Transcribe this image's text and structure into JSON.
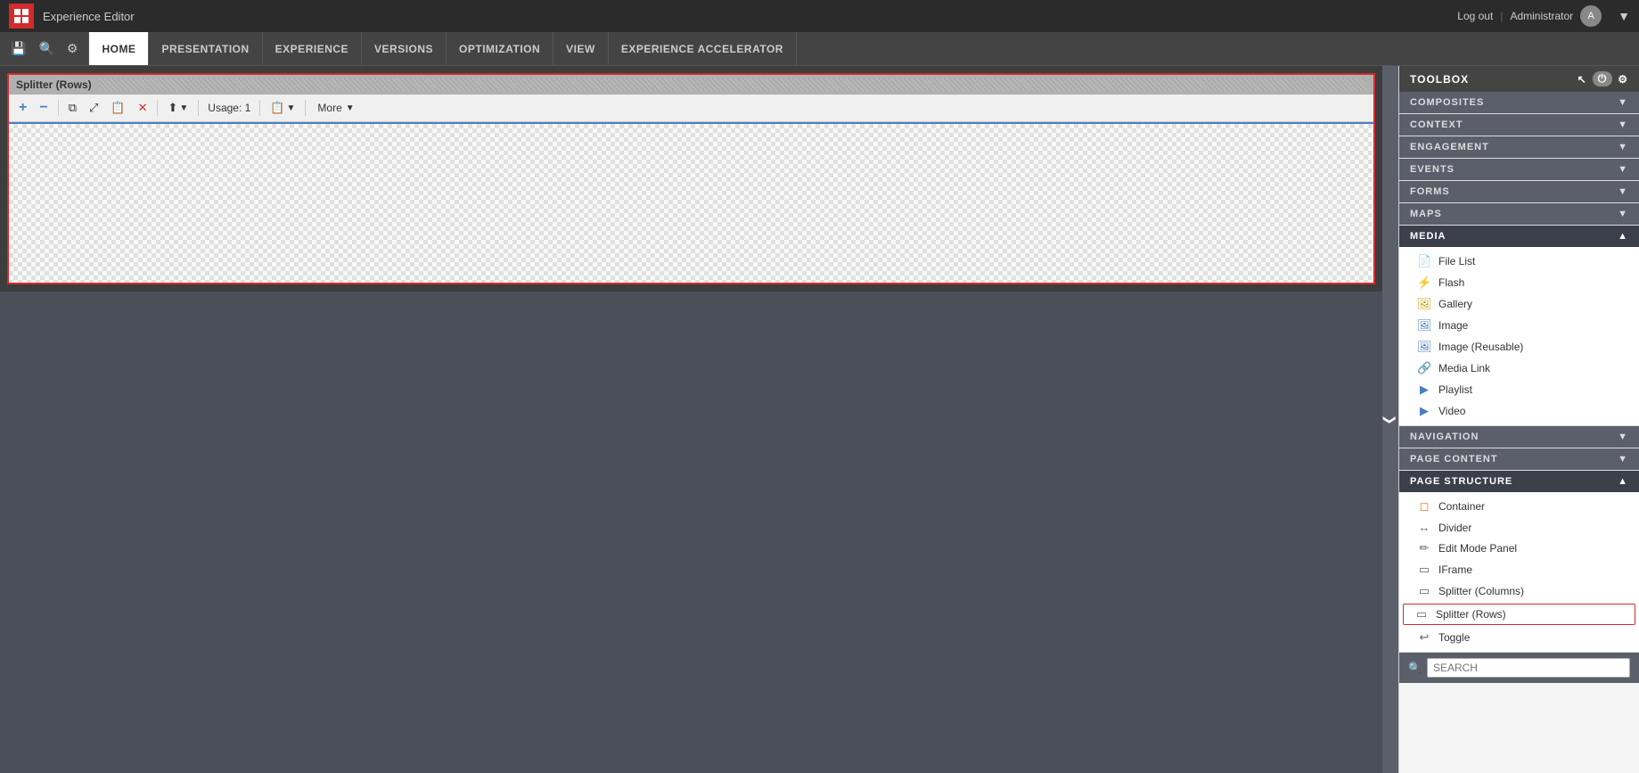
{
  "app": {
    "title": "Experience Editor",
    "logo_label": "Sitecore",
    "logout_label": "Log out",
    "user_label": "Administrator",
    "collapse_icon": "▼"
  },
  "navbar": {
    "tabs": [
      {
        "id": "home",
        "label": "HOME",
        "active": true
      },
      {
        "id": "presentation",
        "label": "PRESENTATION"
      },
      {
        "id": "experience",
        "label": "EXPERIENCE"
      },
      {
        "id": "versions",
        "label": "VERSIONS"
      },
      {
        "id": "optimization",
        "label": "OPTIMIZATION"
      },
      {
        "id": "view",
        "label": "VIEW"
      },
      {
        "id": "experience_accelerator",
        "label": "EXPERIENCE ACCELERATOR"
      }
    ]
  },
  "splitter": {
    "title": "Splitter (Rows)",
    "usage_label": "Usage: 1",
    "more_label": "More",
    "toolbar": {
      "add_icon": "+",
      "remove_icon": "−",
      "copy_icon": "⧉",
      "move_icon": "⤢",
      "paste_icon": "📋",
      "delete_icon": "✕",
      "move_dropdown_icon": "↕",
      "paste_dropdown_icon": "⬇"
    }
  },
  "toolbox": {
    "title": "TOOLBOX",
    "sections": [
      {
        "id": "composites",
        "label": "COMPOSITES",
        "expanded": false
      },
      {
        "id": "context",
        "label": "CONTEXT",
        "expanded": false
      },
      {
        "id": "engagement",
        "label": "ENGAGEMENT",
        "expanded": false
      },
      {
        "id": "events",
        "label": "EVENTS",
        "expanded": false
      },
      {
        "id": "forms",
        "label": "FORMS",
        "expanded": false
      },
      {
        "id": "maps",
        "label": "MAPS",
        "expanded": false
      },
      {
        "id": "media",
        "label": "MEDIA",
        "expanded": true
      },
      {
        "id": "navigation",
        "label": "NAVIGATION",
        "expanded": false
      },
      {
        "id": "page_content",
        "label": "PAGE CONTENT",
        "expanded": false
      },
      {
        "id": "page_structure",
        "label": "PAGE STRUCTURE",
        "expanded": true
      }
    ],
    "media_items": [
      {
        "label": "File List",
        "icon": "📄",
        "icon_type": "doc"
      },
      {
        "label": "Flash",
        "icon": "⚡",
        "icon_type": "flash"
      },
      {
        "label": "Gallery",
        "icon": "🖼",
        "icon_type": "yellow"
      },
      {
        "label": "Image",
        "icon": "🖼",
        "icon_type": "blue"
      },
      {
        "label": "Image (Reusable)",
        "icon": "🖼",
        "icon_type": "blue"
      },
      {
        "label": "Media Link",
        "icon": "🔗",
        "icon_type": "blue"
      },
      {
        "label": "Playlist",
        "icon": "▶",
        "icon_type": "blue"
      },
      {
        "label": "Video",
        "icon": "▶",
        "icon_type": "blue"
      }
    ],
    "page_structure_items": [
      {
        "label": "Container",
        "icon": "◻",
        "icon_type": "orange"
      },
      {
        "label": "Divider",
        "icon": "↔",
        "icon_type": "normal"
      },
      {
        "label": "Edit Mode Panel",
        "icon": "✏",
        "icon_type": "normal"
      },
      {
        "label": "IFrame",
        "icon": "▭",
        "icon_type": "normal"
      },
      {
        "label": "Splitter (Columns)",
        "icon": "▭",
        "icon_type": "normal"
      },
      {
        "label": "Splitter (Rows)",
        "icon": "▭",
        "icon_type": "normal",
        "highlighted": true
      },
      {
        "label": "Toggle",
        "icon": "↩",
        "icon_type": "normal"
      }
    ],
    "search_placeholder": "SEARCH"
  },
  "sidebar_toggle": {
    "icon": "❯"
  }
}
